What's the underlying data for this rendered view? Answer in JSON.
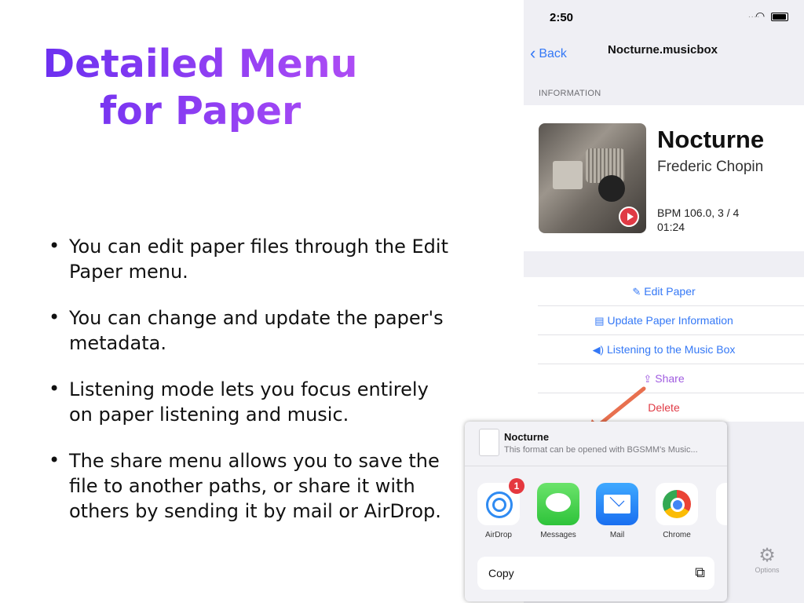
{
  "slide": {
    "title_line1": "Detailed Menu",
    "title_line2": "for Paper",
    "bullets": [
      "You can edit paper files through the Edit Paper menu.",
      "You can change and update the paper's metadata.",
      "Listening mode lets you focus entirely on paper listening and music.",
      "The share menu allows you to save the file to another paths, or share it with others by sending it by mail or AirDrop."
    ]
  },
  "status_bar": {
    "time": "2:50"
  },
  "navbar": {
    "back_label": "Back",
    "title": "Nocturne.musicbox"
  },
  "info": {
    "section_header": "INFORMATION",
    "title": "Nocturne",
    "artist": "Frederic Chopin",
    "bpm_line": "BPM 106.0, 3 / 4",
    "duration": "01:24"
  },
  "actions": {
    "edit": "Edit Paper",
    "update": "Update Paper Information",
    "listen": "Listening to the Music Box",
    "share": "Share",
    "delete": "Delete"
  },
  "options_label": "Options",
  "share_sheet": {
    "file_name": "Nocturne",
    "file_desc": "This format can be opened with BGSMM's Music...",
    "apps": [
      {
        "label": "AirDrop",
        "icon": "airdrop-icon",
        "badge": "1"
      },
      {
        "label": "Messages",
        "icon": "messages-icon"
      },
      {
        "label": "Mail",
        "icon": "mail-icon"
      },
      {
        "label": "Chrome",
        "icon": "chrome-icon"
      }
    ],
    "copy_label": "Copy"
  },
  "colors": {
    "title_gradient_start": "#6a2ff0",
    "title_gradient_end": "#b04df5",
    "ios_blue": "#3478f6",
    "share_purple": "#a05ce0",
    "delete_red": "#e03a45",
    "arrow": "#e8704f"
  }
}
